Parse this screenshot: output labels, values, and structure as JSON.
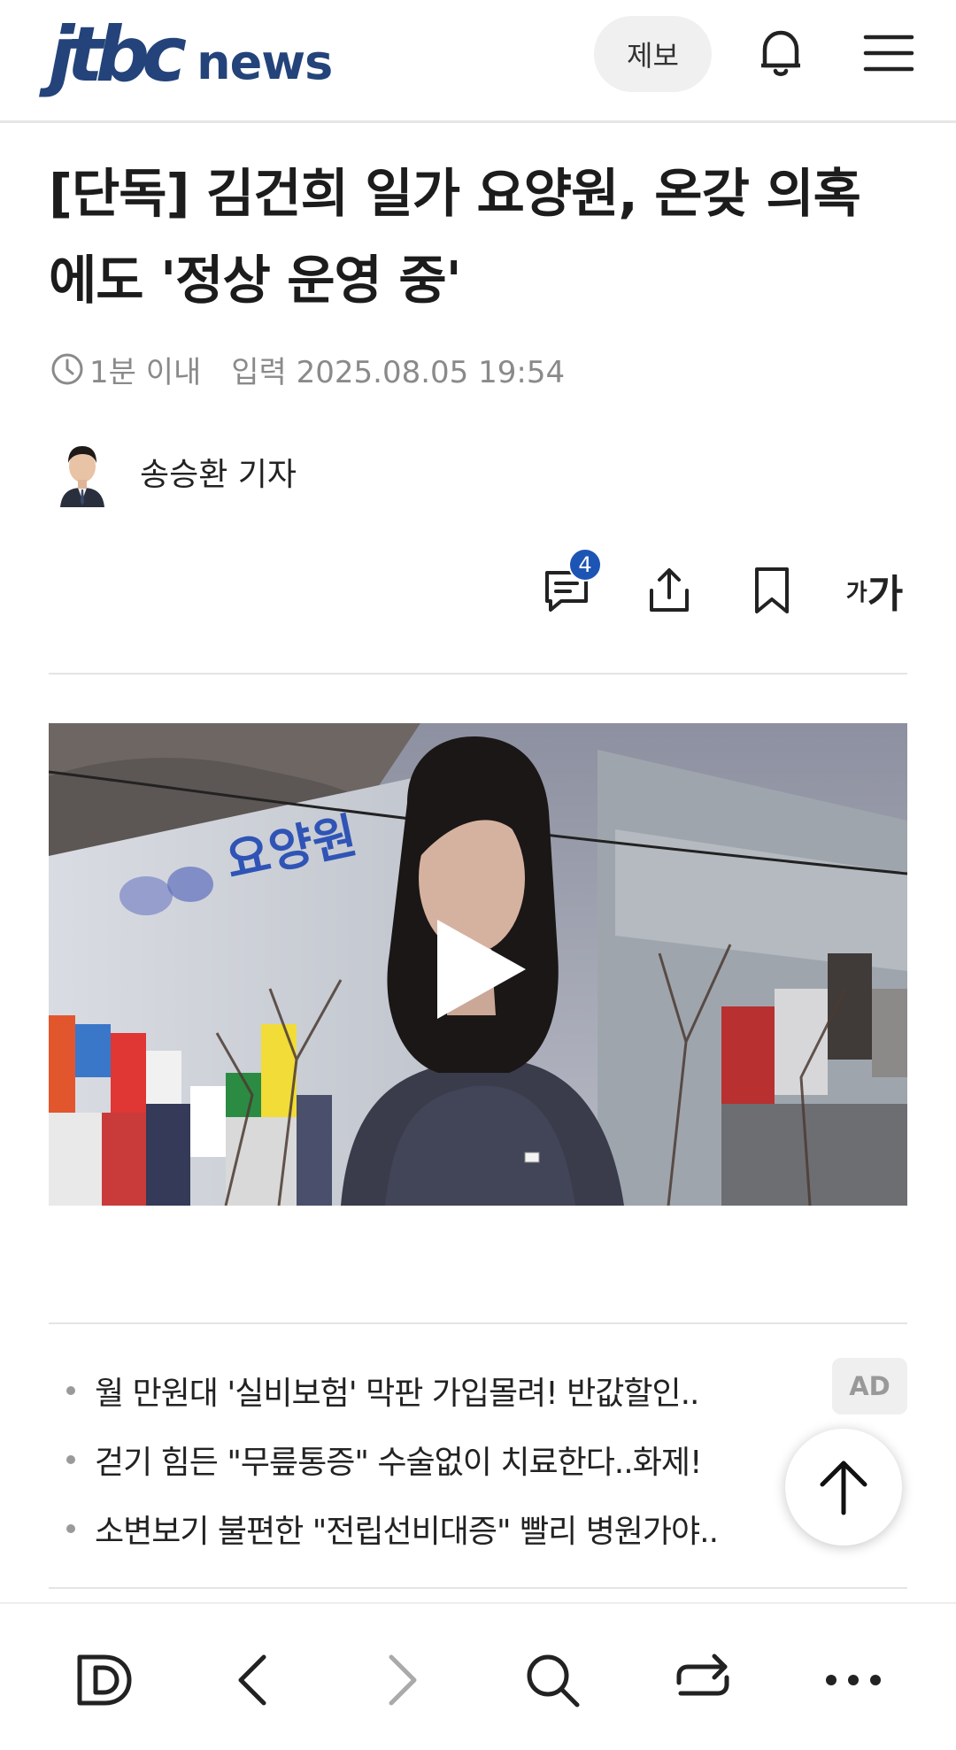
{
  "header": {
    "logo_mark": "jtbc",
    "logo_text": "news",
    "tip_button": "제보",
    "bell_icon": "bell-icon",
    "menu_icon": "hamburger-menu-icon",
    "brand_color": "#23437a"
  },
  "article": {
    "title": "[단독] 김건희 일가 요양원, 온갖 의혹에도 '정상 운영 중'",
    "read_time": "1분 이내",
    "published": "입력 2025.08.05 19:54",
    "reporter": "송승환 기자",
    "comment_count": "4",
    "font_size_label_small": "가",
    "font_size_label_large": "가",
    "video_overlay_text": "요양원"
  },
  "ads": {
    "badge": "AD",
    "items": [
      "월 만원대 '실비보험' 막판 가입몰려! 반값할인..",
      "걷기 힘든 \"무릎통증\" 수술없이 치료한다..화제!",
      "소변보기 불편한 \"전립선비대증\" 빨리 병원가야.."
    ]
  },
  "colors": {
    "badge_blue": "#1d55b5",
    "text_dark": "#1c1c1c",
    "meta_gray": "#8a8a8a"
  }
}
